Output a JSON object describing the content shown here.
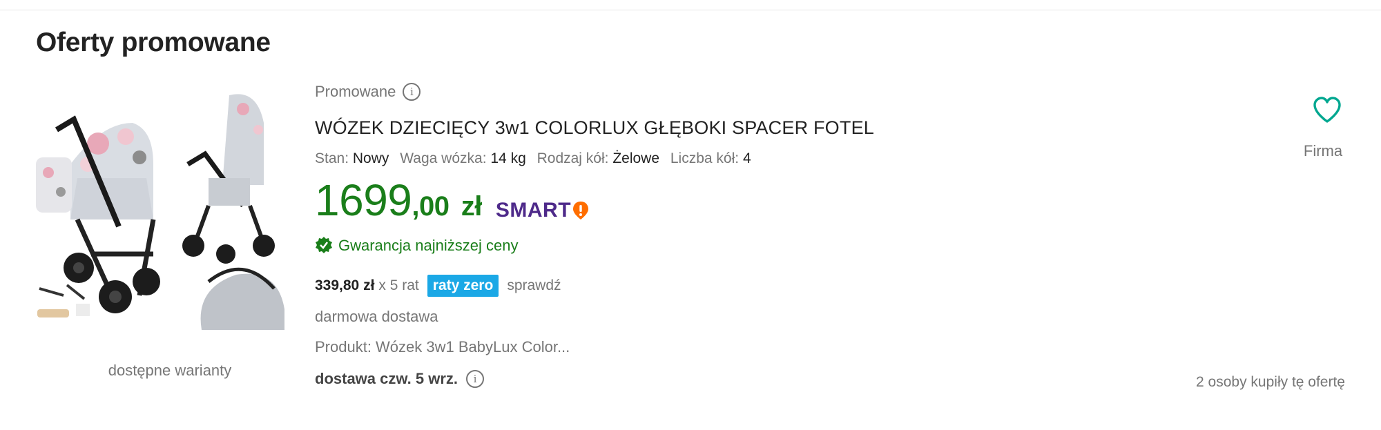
{
  "section": {
    "title": "Oferty promowane"
  },
  "offer": {
    "image_caption": "dostępne warianty",
    "promoted_label": "Promowane",
    "title": "WÓZEK DZIECIĘCY 3w1 COLORLUX GŁĘBOKI SPACER FOTEL",
    "params": [
      {
        "label": "Stan:",
        "value": "Nowy"
      },
      {
        "label": "Waga wózka:",
        "value": "14 kg"
      },
      {
        "label": "Rodzaj kół:",
        "value": "Żelowe"
      },
      {
        "label": "Liczba kół:",
        "value": "4"
      }
    ],
    "price": {
      "main": "1699",
      "cents": ",00",
      "currency": "zł"
    },
    "smart_label": "SMART",
    "guarantee": "Gwarancja najniższej ceny",
    "installments": {
      "amount": "339,80 zł",
      "count": "x 5 rat",
      "badge": "raty zero",
      "link": "sprawdź"
    },
    "free_delivery": "darmowa dostawa",
    "product": "Produkt: Wózek 3w1 BabyLux Color...",
    "delivery": "dostawa czw. 5 wrz.",
    "seller_type": "Firma",
    "buyers": "2 osoby kupiły tę ofertę"
  },
  "colors": {
    "price_green": "#1a7e1a",
    "smart_purple": "#4e2a8a",
    "smart_orange": "#ff6e00",
    "raty_blue": "#1ba8e6",
    "heart_teal": "#00a790"
  },
  "icons": {
    "info": "info-circle-icon",
    "heart": "heart-outline-icon",
    "guarantee": "green-check-badge-icon"
  }
}
